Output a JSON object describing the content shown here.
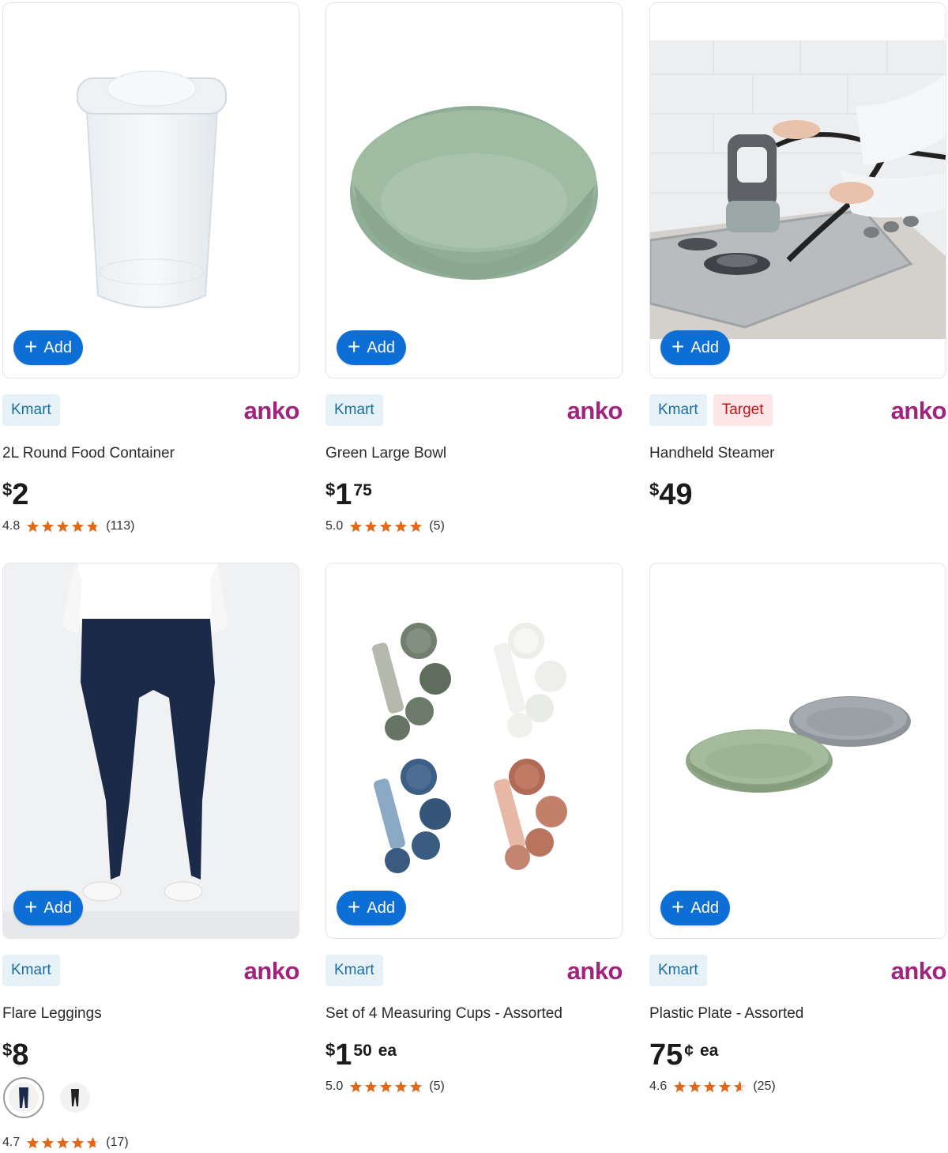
{
  "colors": {
    "accent": "#0d6fd6",
    "kmart_tag": "#1b6f9c",
    "target_tag": "#c0141a",
    "brand": "#a0237c",
    "star": "#e0691a"
  },
  "add_label": "Add",
  "products": [
    {
      "title": "2L Round Food Container",
      "tags": [
        "Kmart"
      ],
      "brand": "anko",
      "price_symbol": "$",
      "price_main": "2",
      "price_cents": "",
      "price_suffix": "",
      "rating": "4.8",
      "reviews": "(113)",
      "image": "clear-food-container"
    },
    {
      "title": "Green Large Bowl",
      "tags": [
        "Kmart"
      ],
      "brand": "anko",
      "price_symbol": "$",
      "price_main": "1",
      "price_cents": "75",
      "price_suffix": "",
      "rating": "5.0",
      "reviews": "(5)",
      "image": "green-bowl"
    },
    {
      "title": "Handheld Steamer",
      "tags": [
        "Kmart",
        "Target"
      ],
      "brand": "anko",
      "price_symbol": "$",
      "price_main": "49",
      "price_cents": "",
      "price_suffix": "",
      "rating": "",
      "reviews": "",
      "image": "steamer-on-cooktop"
    },
    {
      "title": "Flare Leggings",
      "tags": [
        "Kmart"
      ],
      "brand": "anko",
      "price_symbol": "$",
      "price_main": "8",
      "price_cents": "",
      "price_suffix": "",
      "rating": "4.7",
      "reviews": "(17)",
      "image": "navy-flare-leggings",
      "swatches": [
        "navy",
        "black"
      ]
    },
    {
      "title": "Set of 4 Measuring Cups - Assorted",
      "tags": [
        "Kmart"
      ],
      "brand": "anko",
      "price_symbol": "$",
      "price_main": "1",
      "price_cents": "50",
      "price_suffix": "ea",
      "rating": "5.0",
      "reviews": "(5)",
      "image": "measuring-cups"
    },
    {
      "title": "Plastic Plate - Assorted",
      "tags": [
        "Kmart"
      ],
      "brand": "anko",
      "price_symbol": "",
      "price_main": "75",
      "price_cents": "¢",
      "price_suffix": "ea",
      "rating": "4.6",
      "reviews": "(25)",
      "image": "plastic-plates"
    }
  ]
}
